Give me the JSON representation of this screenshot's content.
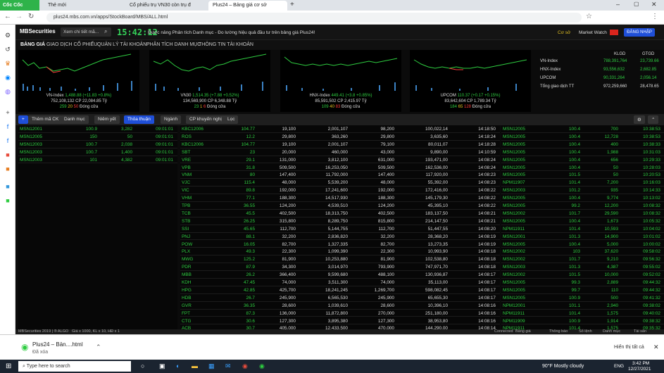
{
  "browser": {
    "brand": "Cốc Cốc",
    "tabs": [
      "Thẻ mới",
      "Cổ phiếu trụ VN30 còn trụ đ",
      "Plus24 – Bảng giá cơ sở"
    ],
    "url": "plus24.mbs.com.vn/apps/StockBoard/MBS/ALL.html"
  },
  "header": {
    "logo": "MBSecurities",
    "search_placeholder": "Xem chi tiết mã...",
    "clock": "15:42:12",
    "marquee": "Được nâng Phân tích Danh mục - Đo lường hiệu quả đầu tư trên bảng giá Plus24!",
    "account": "Cơ sở",
    "market_watch": "Market Watch",
    "register": "ĐĂNG NHẬP"
  },
  "nav": [
    "BẢNG GIÁ",
    "GIAO DỊCH CỔ PHIẾU",
    "QUẢN LÝ TÀI KHOẢN",
    "PHÂN TÍCH DANH MỤC",
    "THÔNG TIN TÀI KHOẢN"
  ],
  "indices": [
    {
      "name": "VN-Index",
      "value": "1,488.88",
      "change": "(+11.83 +0.8%)",
      "vol": "752,108,132",
      "cp": "22,084.85",
      "unit": "Tỷ",
      "up": "259",
      "ref": "20",
      "down": "50",
      "ceil": "11",
      "floor": "3",
      "status": "Đóng cửa"
    },
    {
      "name": "VN30",
      "value": "1,514.35",
      "change": "(+7.88 +0.52%)",
      "vol": "134,569,900",
      "cp": "6,348.88",
      "unit": "Tỷ",
      "up": "23",
      "ref": "1",
      "down": "6",
      "ceil": "0",
      "floor": "0",
      "status": "Đóng cửa"
    },
    {
      "name": "HNX-Index",
      "value": "449.41",
      "change": "(+3.8 +0.85%)",
      "vol": "85,591,502",
      "cp": "2,415.97",
      "unit": "Tỷ",
      "up": "109",
      "ref": "40",
      "down": "83",
      "ceil": "",
      "floor": "",
      "status": "Đóng cửa"
    },
    {
      "name": "UPCOM",
      "value": "110.37",
      "change": "(+0.17 +0.15%)",
      "vol": "83,642,604",
      "cp": "1,789.34",
      "unit": "Tỷ",
      "up": "184",
      "ref": "65",
      "down": "128",
      "ceil": "",
      "floor": "",
      "status": "Đóng cửa"
    }
  ],
  "summary": {
    "headers": [
      "KLGD",
      "GTGD"
    ],
    "rows": [
      {
        "name": "VN-Index",
        "klgd": "788,391,764",
        "gtgd": "23,739.66"
      },
      {
        "name": "HNX-Index",
        "klgd": "93,556,632",
        "gtgd": "2,682.85"
      },
      {
        "name": "UPCOM",
        "klgd": "90,331,264",
        "gtgd": "2,056.14"
      },
      {
        "name": "Tổng giao dịch TT",
        "klgd": "972,259,660",
        "gtgd": "28,478.65"
      }
    ]
  },
  "toolbar": {
    "add": "Thêm mã CK",
    "b1": "Danh mục",
    "b2": "Niêm yết",
    "b3": "Thỏa thuận",
    "b4": "Ngành",
    "b5": "CP khuyến nghị",
    "b6": "Lọc"
  },
  "left_rows": [
    [
      "MSN12001",
      "100.9",
      "3,282",
      "09:01:01"
    ],
    [
      "MSN12005",
      "150",
      "50",
      "09:01:01"
    ],
    [
      "MSN12003",
      "100.7",
      "2,038",
      "09:01:01"
    ],
    [
      "MSN12003",
      "100.7",
      "1,400",
      "09:01:01"
    ],
    [
      "MSN12003",
      "101",
      "4,382",
      "09:01:01"
    ]
  ],
  "mid_rows": [
    [
      "KBC12006",
      "104.77",
      "19,100",
      "2,001,107",
      "98,200",
      "100,022,14",
      "14:18:50"
    ],
    [
      "ROS",
      "12.2",
      "29,800",
      "363,260",
      "29,800",
      "3,635,60",
      "14:18:24"
    ],
    [
      "KBC12006",
      "104.77",
      "19,100",
      "2,001,107",
      "79,100",
      "80,011,07",
      "14:18:28"
    ],
    [
      "SBT",
      "23",
      "20,000",
      "460,000",
      "43,000",
      "9,890,00",
      "14:10:59"
    ],
    [
      "VRE",
      "29.1",
      "131,000",
      "3,812,100",
      "631,000",
      "193,471,00",
      "14:08:24"
    ],
    [
      "VPB",
      "31.8",
      "509,500",
      "16,253,050",
      "509,500",
      "162,536,00",
      "14:08:24"
    ],
    [
      "VNM",
      "80",
      "147,400",
      "11,792,000",
      "147,400",
      "117,920,00",
      "14:08:23"
    ],
    [
      "VJC",
      "115.4",
      "48,000",
      "5,539,200",
      "48,000",
      "55,392,00",
      "14:08:23"
    ],
    [
      "VIC",
      "89.8",
      "192,000",
      "17,241,600",
      "192,000",
      "172,416,00",
      "14:08:22"
    ],
    [
      "VHM",
      "77.1",
      "188,300",
      "14,517,930",
      "188,300",
      "145,179,30",
      "14:08:22"
    ],
    [
      "TPB",
      "36.55",
      "124,200",
      "4,539,510",
      "124,200",
      "45,395,10",
      "14:08:22"
    ],
    [
      "TCB",
      "45.5",
      "402,500",
      "18,313,750",
      "402,500",
      "183,137,50",
      "14:08:21"
    ],
    [
      "STB",
      "26.25",
      "315,800",
      "8,289,750",
      "815,800",
      "214,147,50",
      "14:08:21"
    ],
    [
      "SSI",
      "45.65",
      "112,700",
      "5,144,755",
      "112,700",
      "51,447,55",
      "14:08:20"
    ],
    [
      "PNJ",
      "88.1",
      "32,200",
      "2,836,820",
      "32,200",
      "28,368,20",
      "14:08:19"
    ],
    [
      "POW",
      "16.05",
      "82,700",
      "1,327,335",
      "82,700",
      "13,273,35",
      "14:08:19"
    ],
    [
      "PLX",
      "49.3",
      "22,300",
      "1,099,390",
      "22,300",
      "10,993,90",
      "14:08:18"
    ],
    [
      "MWG",
      "125.2",
      "81,900",
      "10,253,880",
      "81,900",
      "102,538,80",
      "14:08:18"
    ],
    [
      "PDR",
      "87.9",
      "34,300",
      "3,014,970",
      "793,900",
      "747,971,70",
      "14:08:18"
    ],
    [
      "MBB",
      "26.2",
      "366,400",
      "9,599,680",
      "488,100",
      "130,936,87",
      "14:08:17"
    ],
    [
      "KDH",
      "47.45",
      "74,000",
      "3,511,300",
      "74,000",
      "35,113,00",
      "14:08:17"
    ],
    [
      "HPG",
      "42.85",
      "425,700",
      "18,241,245",
      "1,269,700",
      "598,082,45",
      "14:08:17"
    ],
    [
      "HDB",
      "26.7",
      "245,900",
      "6,565,530",
      "245,900",
      "65,655,30",
      "14:08:17"
    ],
    [
      "GVR",
      "36.35",
      "28,600",
      "1,039,610",
      "28,600",
      "10,396,10",
      "14:08:16"
    ],
    [
      "FPT",
      "87.3",
      "136,000",
      "11,872,800",
      "270,000",
      "251,180,00",
      "14:08:16"
    ],
    [
      "CTG",
      "30.6",
      "127,300",
      "3,895,380",
      "127,300",
      "38,953,80",
      "14:08:16"
    ],
    [
      "ACB",
      "30.7",
      "405,000",
      "12,433,500",
      "470,000",
      "144,290,00",
      "14:08:14"
    ]
  ],
  "right_rows": [
    [
      "MSN12005",
      "100.4",
      "700",
      "10:38:53"
    ],
    [
      "MSN12005",
      "100.4",
      "12,728",
      "10:38:53"
    ],
    [
      "MSN12005",
      "100.4",
      "400",
      "10:38:33"
    ],
    [
      "MSN12005",
      "100.4",
      "1,988",
      "10:31:03"
    ],
    [
      "MSN12005",
      "100.4",
      "656",
      "10:29:33"
    ],
    [
      "MSN12005",
      "100.4",
      "50",
      "10:28:03"
    ],
    [
      "MSN12005",
      "101.5",
      "50",
      "10:20:53"
    ],
    [
      "NPM11907",
      "101.4",
      "7,200",
      "10:16:03"
    ],
    [
      "MSN12003",
      "101.2",
      "935",
      "10:14:33"
    ],
    [
      "MSN12005",
      "100.4",
      "9,774",
      "10:13:02"
    ],
    [
      "MSN12005",
      "99.2",
      "12,200",
      "10:08:32"
    ],
    [
      "MSN12002",
      "101.7",
      "29,590",
      "10:08:32"
    ],
    [
      "MSN12005",
      "100.4",
      "1,673",
      "10:05:32"
    ],
    [
      "NPM11911",
      "101.4",
      "10,593",
      "10:04:02"
    ],
    [
      "MSN12001",
      "101.3",
      "14,900",
      "10:01:02"
    ],
    [
      "MSN12005",
      "100.4",
      "5,000",
      "10:00:02"
    ],
    [
      "MSN12002",
      "103",
      "37,620",
      "09:58:02"
    ],
    [
      "MSN12002",
      "101.7",
      "9,210",
      "09:56:32"
    ],
    [
      "MSN12003",
      "101.3",
      "4,387",
      "09:55:02"
    ],
    [
      "MSN12002",
      "101.5",
      "10,000",
      "09:52:02"
    ],
    [
      "MSN12005",
      "99.3",
      "2,889",
      "09:44:32"
    ],
    [
      "MSN12005",
      "99.7",
      "110",
      "09:44:32"
    ],
    [
      "MSN12005",
      "100.9",
      "500",
      "09:41:32"
    ],
    [
      "NPM12001",
      "101.1",
      "2,940",
      "09:38:02"
    ],
    [
      "NPM11911",
      "101.4",
      "1,575",
      "09:40:02"
    ],
    [
      "NPM11909",
      "100.9",
      "1,914",
      "09:38:32"
    ],
    [
      "NPM11911",
      "101.4",
      "1,575",
      "09:35:32"
    ]
  ],
  "status": {
    "left": "MBSecurities 2019 | ® ALGO",
    "mid": "Giá x 1000, KL x 10, HĐ x 1",
    "items": [
      "Connected",
      "Bảng giá",
      "Thông báo",
      "Sổ lệnh",
      "Danh mục",
      "Tài sản"
    ]
  },
  "download": {
    "file": "Plus24 – Bản....html",
    "state": "Đã xóa",
    "show_all": "Hiển thị tất cả"
  },
  "taskbar": {
    "search": "Type here to search",
    "weather": "90°F  Mostly cloudy",
    "lang": "ENG",
    "time": "3:42 PM",
    "date": "12/27/2021"
  },
  "colors": {
    "up": "#2ecc40",
    "ref": "#e2c023",
    "down": "#ff3b3b",
    "accent": "#1f4fd8"
  }
}
